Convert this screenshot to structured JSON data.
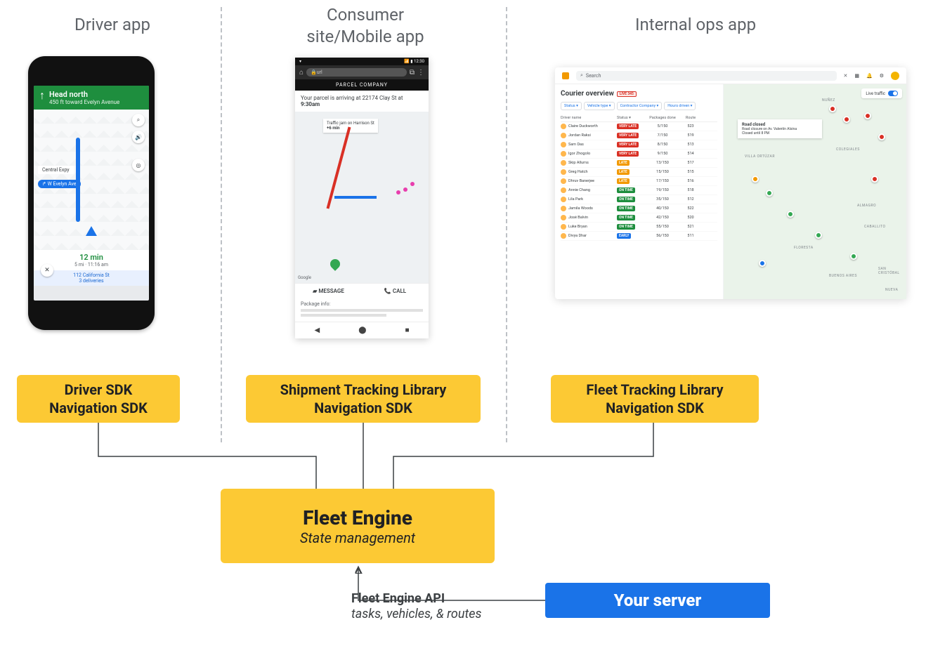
{
  "columns": {
    "driver": "Driver app",
    "consumer": "Consumer\nsite/Mobile app",
    "ops": "Internal ops app"
  },
  "driver_app": {
    "nav_direction": "Head north",
    "nav_distance": "450 ft",
    "nav_toward": "toward Evelyn Avenue",
    "chip_street": "W Evelyn Ave",
    "label_expwy": "Central Expy",
    "eta": "12 min",
    "eta_sub": "5 mi · 11:16 am",
    "footer_line1": "112 California St",
    "footer_line2": "3 deliveries"
  },
  "consumer_app": {
    "status_time": "12:30",
    "url_text": "url",
    "company": "PARCEL COMPANY",
    "arrival_prefix": "Your parcel is arriving at 22174 Clay St at",
    "arrival_time": "9:30am",
    "traffic_line1": "Traffic jam on Harrison St",
    "traffic_line2": "+6 min",
    "attribution": "Google",
    "action_message": "MESSAGE",
    "action_call": "CALL",
    "package_info_label": "Package info:"
  },
  "ops_app": {
    "search_placeholder": "Search",
    "title": "Courier overview",
    "live_badge": "LIVE 345",
    "filters": [
      "Status",
      "Vehicle type",
      "Contractor Company",
      "Hours driven"
    ],
    "columns": [
      "Driver name",
      "Status",
      "Packages done",
      "Route"
    ],
    "rows": [
      {
        "name": "Claire Duckworth",
        "status": "VERY LATE",
        "status_class": "s-verylate",
        "pkg": "5/150",
        "route": "523"
      },
      {
        "name": "Jordan Raksi",
        "status": "VERY LATE",
        "status_class": "s-verylate",
        "pkg": "7/150",
        "route": "519"
      },
      {
        "name": "Sam Das",
        "status": "VERY LATE",
        "status_class": "s-verylate",
        "pkg": "8/150",
        "route": "513"
      },
      {
        "name": "Igor Zhogolo",
        "status": "VERY LATE",
        "status_class": "s-verylate",
        "pkg": "9/150",
        "route": "514"
      },
      {
        "name": "Skip Allums",
        "status": "LATE",
        "status_class": "s-late",
        "pkg": "13/150",
        "route": "517"
      },
      {
        "name": "Greg Hatch",
        "status": "LATE",
        "status_class": "s-late",
        "pkg": "15/150",
        "route": "515"
      },
      {
        "name": "Dhruv Banerjee",
        "status": "LATE",
        "status_class": "s-late",
        "pkg": "17/150",
        "route": "516"
      },
      {
        "name": "Annie Chang",
        "status": "ON TIME",
        "status_class": "s-ontime",
        "pkg": "19/150",
        "route": "518"
      },
      {
        "name": "Lila Park",
        "status": "ON TIME",
        "status_class": "s-ontime",
        "pkg": "35/150",
        "route": "512"
      },
      {
        "name": "Jamila Woods",
        "status": "ON TIME",
        "status_class": "s-ontime",
        "pkg": "40/150",
        "route": "522"
      },
      {
        "name": "José Balvin",
        "status": "ON TIME",
        "status_class": "s-ontime",
        "pkg": "42/150",
        "route": "520"
      },
      {
        "name": "Luke Bryan",
        "status": "ON TIME",
        "status_class": "s-ontime",
        "pkg": "55/150",
        "route": "521"
      },
      {
        "name": "Divya Dhar",
        "status": "EARLY",
        "status_class": "s-early",
        "pkg": "56/150",
        "route": "511"
      }
    ],
    "live_traffic": "Live traffic",
    "popup_title": "Road closed",
    "popup_line1": "Road closure on Av. Valentín Alsina",
    "popup_line2": "Closed until 8 PM",
    "map_labels": [
      "NUÑEZ",
      "COLEGIALES",
      "VILLA ORTÚZAR",
      "ALMAGRO",
      "CABALLITO",
      "FLORESTA",
      "BUENOS AIRES",
      "SAN CRISTÓBAL",
      "NUEVA"
    ]
  },
  "sdk": {
    "driver_l1": "Driver SDK",
    "driver_l2": "Navigation SDK",
    "consumer_l1": "Shipment Tracking Library",
    "consumer_l2": "Navigation SDK",
    "ops_l1": "Fleet Tracking Library",
    "ops_l2": "Navigation SDK"
  },
  "fleet_engine": {
    "title": "Fleet Engine",
    "subtitle": "State management"
  },
  "server": "Your server",
  "api": {
    "title": "Fleet Engine API",
    "subtitle": "tasks, vehicles, & routes"
  }
}
